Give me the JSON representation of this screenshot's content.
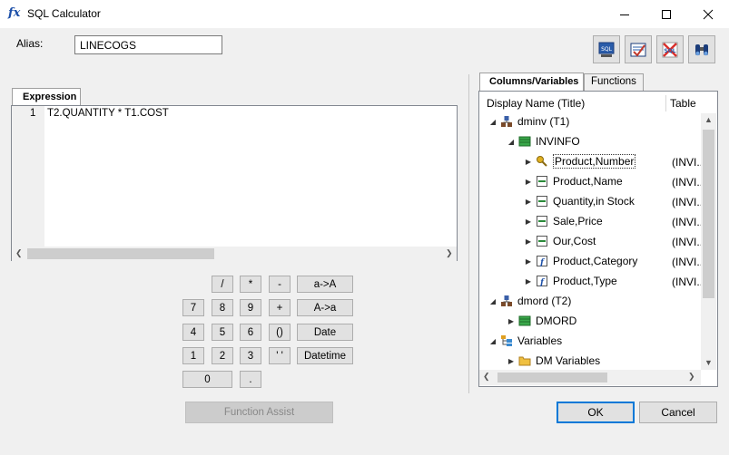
{
  "window": {
    "title": "SQL Calculator",
    "app_icon_glyph": "fx"
  },
  "alias": {
    "label": "Alias:",
    "value": "LINECOGS"
  },
  "toolbar": {
    "buttons": [
      "sql-view-icon",
      "validate-icon",
      "sql-check-icon",
      "browse-icon"
    ]
  },
  "expression": {
    "tab_label": "Expression",
    "line_number": "1",
    "text": "T2.QUANTITY * T1.COST"
  },
  "keypad": {
    "row1": [
      "/",
      "*",
      "-",
      "a->A"
    ],
    "row2": [
      "7",
      "8",
      "9",
      "+",
      "A->a"
    ],
    "row3": [
      "4",
      "5",
      "6",
      "()",
      "Date"
    ],
    "row4": [
      "1",
      "2",
      "3",
      "' '",
      "Datetime"
    ],
    "row5": [
      "0",
      "."
    ]
  },
  "function_assist_label": "Function Assist",
  "tabs": {
    "columns": "Columns/Variables",
    "functions": "Functions"
  },
  "tree": {
    "header_name": "Display Name (Title)",
    "header_table": "Table",
    "nodes": [
      {
        "label": "dminv (T1)",
        "table": ""
      },
      {
        "label": "INVINFO",
        "table": ""
      },
      {
        "label": "Product,Number",
        "table": "(INVI..."
      },
      {
        "label": "Product,Name",
        "table": "(INVI..."
      },
      {
        "label": "Quantity,in Stock",
        "table": "(INVI..."
      },
      {
        "label": "Sale,Price",
        "table": "(INVI..."
      },
      {
        "label": "Our,Cost",
        "table": "(INVI..."
      },
      {
        "label": "Product,Category",
        "table": "(INVI..."
      },
      {
        "label": "Product,Type",
        "table": "(INVI..."
      },
      {
        "label": "dmord (T2)",
        "table": ""
      },
      {
        "label": "DMORD",
        "table": ""
      },
      {
        "label": "Variables",
        "table": ""
      },
      {
        "label": "DM Variables",
        "table": ""
      }
    ]
  },
  "buttons": {
    "ok": "OK",
    "cancel": "Cancel"
  }
}
